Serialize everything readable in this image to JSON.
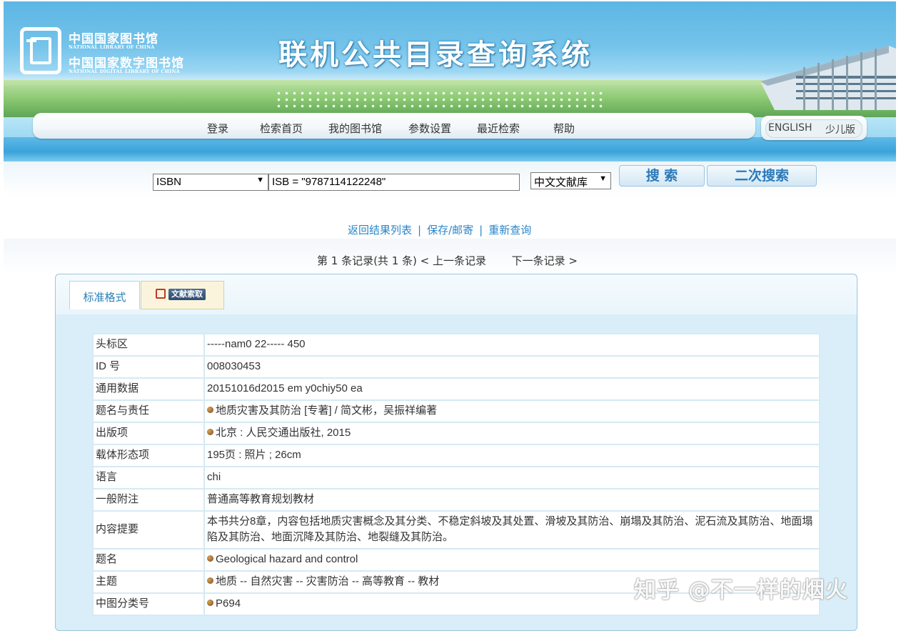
{
  "header": {
    "logo_cn_1": "中国国家图书馆",
    "logo_en_1": "NATIONAL LIBRARY OF CHINA",
    "logo_cn_2": "中国国家数字图书馆",
    "logo_en_2": "NATIONAL DIGITAL LIBRARY OF CHINA",
    "system_title": "联机公共目录查询系统"
  },
  "nav": {
    "items": [
      "登录",
      "检索首页",
      "我的图书馆",
      "参数设置",
      "最近检索",
      "帮助"
    ],
    "english": "ENGLISH",
    "kids": "少儿版"
  },
  "search": {
    "field_select": "ISBN",
    "query": "ISB = \"9787114122248\"",
    "database_select": "中文文献库",
    "search_button": "搜 索",
    "refine_button": "二次搜索"
  },
  "actions": {
    "back": "返回结果列表",
    "save": "保存/邮寄",
    "new_query": "重新查询",
    "separator": "|"
  },
  "record_nav": {
    "status": "第 1 条记录(共 1 条)",
    "prev": "< 上一条记录",
    "next": "下一条记录 >"
  },
  "tabs": {
    "standard": "标准格式",
    "doc_request": "文献索取"
  },
  "record": [
    {
      "label": "头标区",
      "value": "-----nam0 22----- 450",
      "link": false
    },
    {
      "label": "ID 号",
      "value": "008030453",
      "link": false
    },
    {
      "label": "通用数据",
      "value": "20151016d2015 em y0chiy50 ea",
      "link": false
    },
    {
      "label": "题名与责任",
      "value": "地质灾害及其防治 [专著] / 简文彬，吴振祥编著",
      "link": true
    },
    {
      "label": "出版项",
      "value": "北京 : 人民交通出版社, 2015",
      "link": true
    },
    {
      "label": "载体形态项",
      "value": "195页 : 照片 ; 26cm",
      "link": false
    },
    {
      "label": "语言",
      "value": "chi",
      "link": false
    },
    {
      "label": "一般附注",
      "value": "普通高等教育规划教材",
      "link": false
    },
    {
      "label": "内容提要",
      "value": "本书共分8章，内容包括地质灾害概念及其分类、不稳定斜坡及其处置、滑坡及其防治、崩塌及其防治、泥石流及其防治、地面塌陷及其防治、地面沉降及其防治、地裂缝及其防治。",
      "link": false
    },
    {
      "label": "题名",
      "value": "Geological hazard and control",
      "link": true
    },
    {
      "label": "主题",
      "value": "地质 -- 自然灾害 -- 灾害防治 -- 高等教育 -- 教材",
      "link": true
    },
    {
      "label": "中图分类号",
      "value": "P694",
      "link": true
    }
  ],
  "watermark": "知乎 @不一样的烟火"
}
